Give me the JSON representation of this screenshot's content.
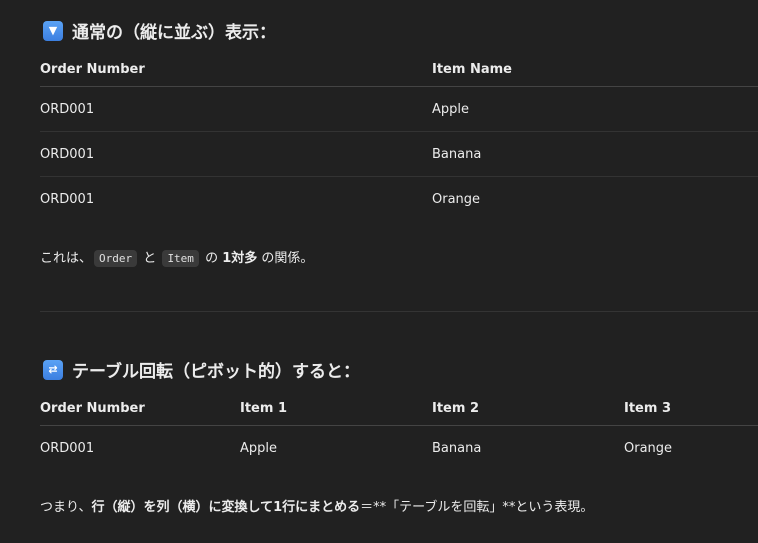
{
  "section1": {
    "icon": "down-arrow-button-icon",
    "title": "通常の（縦に並ぶ）表示：",
    "headers": [
      "Order Number",
      "Item Name"
    ],
    "rows": [
      [
        "ORD001",
        "Apple"
      ],
      [
        "ORD001",
        "Banana"
      ],
      [
        "ORD001",
        "Orange"
      ]
    ],
    "note": {
      "prefix": "これは、",
      "code1": "Order",
      "mid": "と",
      "code2": "Item",
      "of": "の",
      "bold": "1対多",
      "suffix": "の関係。"
    }
  },
  "section2": {
    "icon": "repeat-button-icon",
    "title": "テーブル回転（ピボット的）すると：",
    "headers": [
      "Order Number",
      "Item 1",
      "Item 2",
      "Item 3"
    ],
    "rows": [
      [
        "ORD001",
        "Apple",
        "Banana",
        "Orange"
      ]
    ],
    "note": {
      "prefix": "つまり、",
      "bold": "行（縦）を列（横）に変換して1行にまとめる",
      "suffix": "＝**「テーブルを回転」**という表現。"
    }
  },
  "colors": {
    "background": "#212121",
    "text": "#ececec",
    "divider": "#333333",
    "emoji_blue": "#4a90e2"
  }
}
